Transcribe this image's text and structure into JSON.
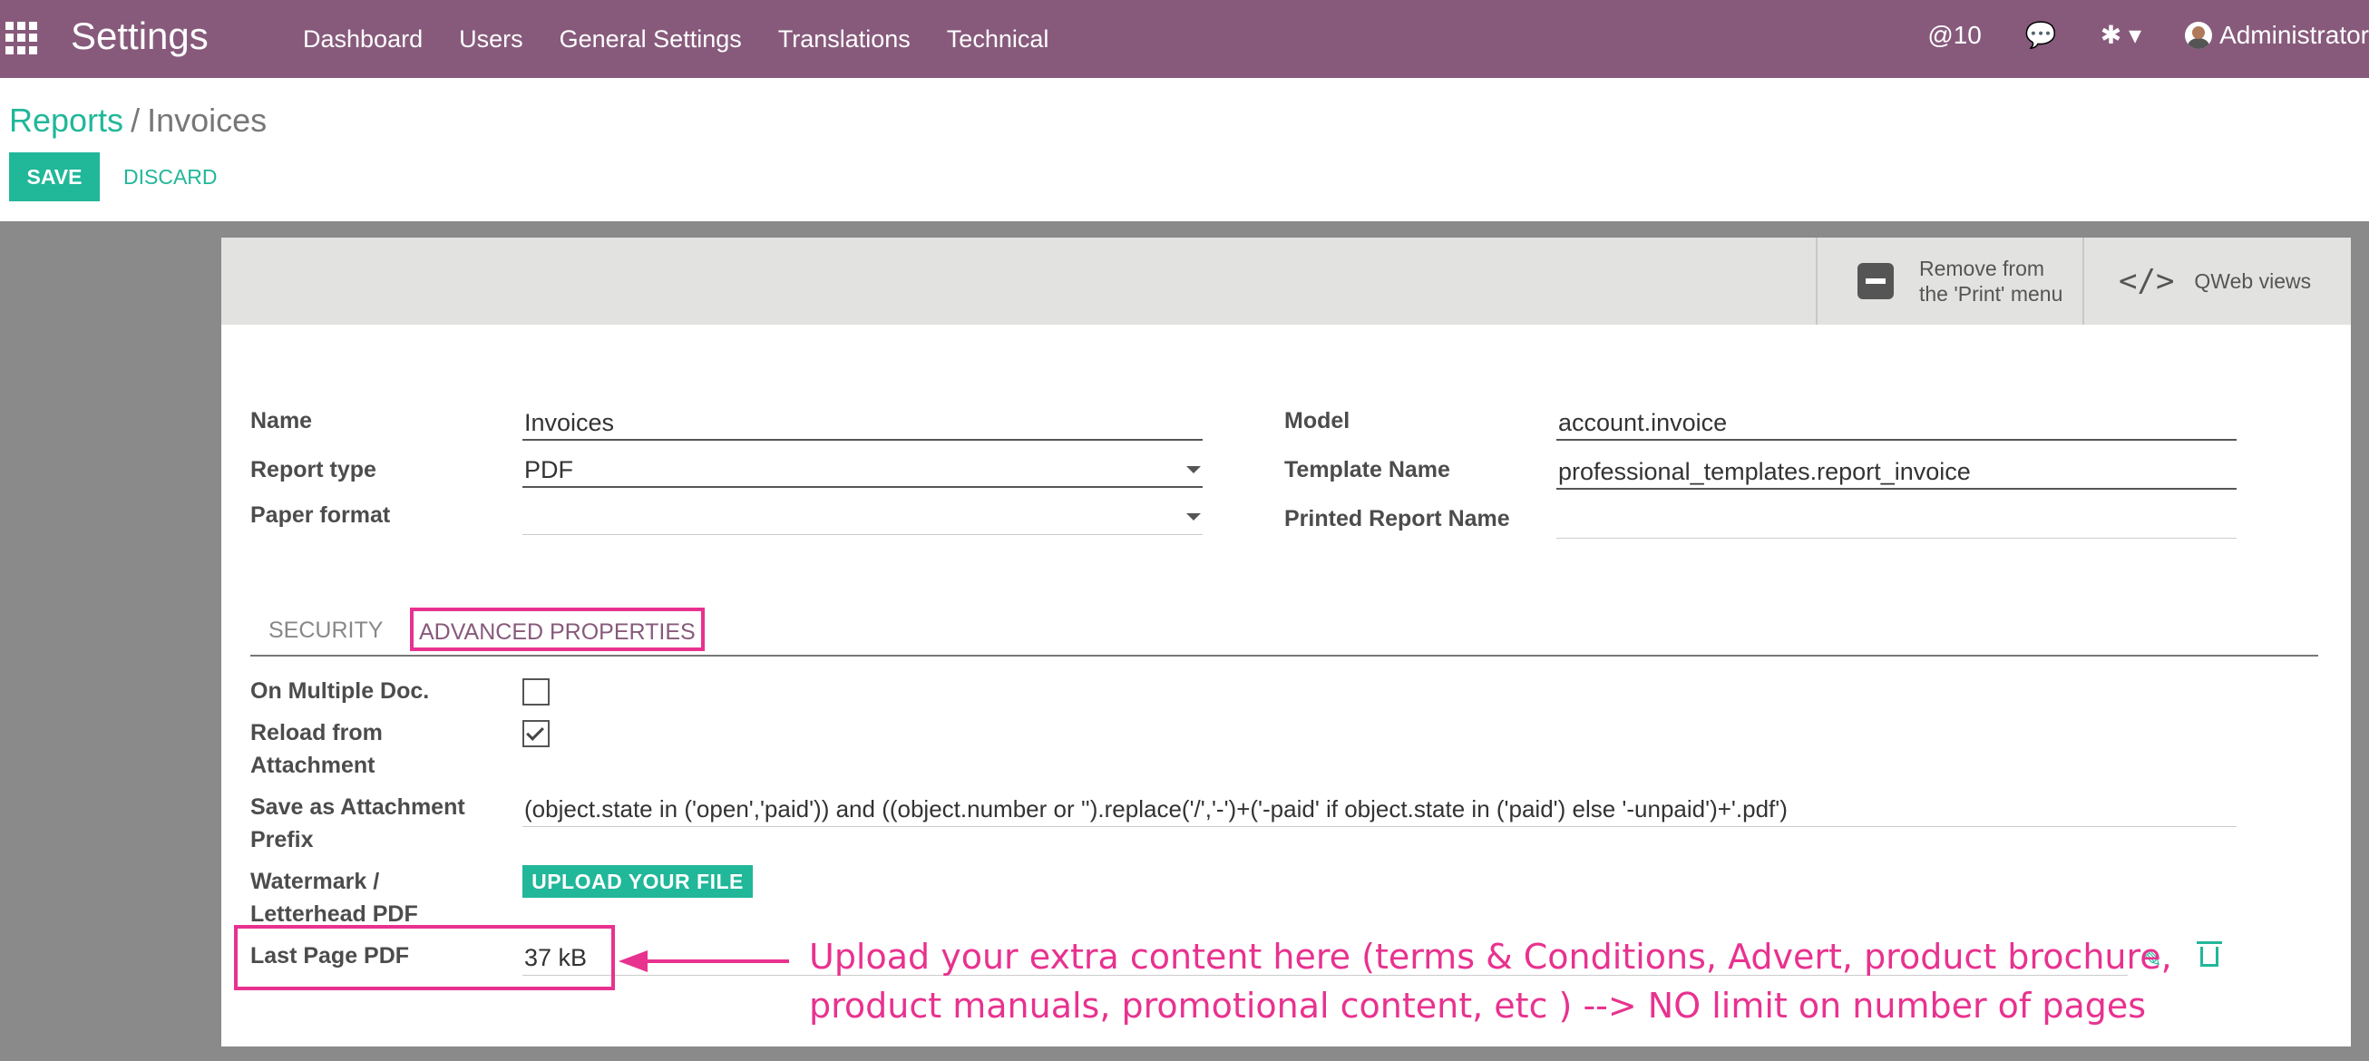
{
  "navbar": {
    "brand": "Settings",
    "menu": [
      "Dashboard",
      "Users",
      "General Settings",
      "Translations",
      "Technical"
    ],
    "mentions": "@10",
    "user": "Administrator"
  },
  "breadcrumb": {
    "parent": "Reports",
    "separator": "/",
    "current": "Invoices"
  },
  "buttons": {
    "save": "SAVE",
    "discard": "DISCARD",
    "upload": "UPLOAD YOUR FILE"
  },
  "button_box": {
    "remove": "Remove from the 'Print' menu",
    "qweb": "QWeb views"
  },
  "form": {
    "name_label": "Name",
    "name_value": "Invoices",
    "report_type_label": "Report type",
    "report_type_value": "PDF",
    "paper_format_label": "Paper format",
    "paper_format_value": "",
    "model_label": "Model",
    "model_value": "account.invoice",
    "template_label": "Template Name",
    "template_value": "professional_templates.report_invoice",
    "printed_name_label": "Printed Report Name",
    "printed_name_value": ""
  },
  "tabs": {
    "security": "SECURITY",
    "advanced": "ADVANCED PROPERTIES"
  },
  "advanced": {
    "multi_doc_label": "On Multiple Doc.",
    "multi_doc_checked": false,
    "reload_label": "Reload from Attachment",
    "reload_checked": true,
    "prefix_label": "Save as Attachment Prefix",
    "prefix_value": "(object.state in ('open','paid')) and ((object.number or '').replace('/','-')+('-paid' if object.state in ('paid') else '-unpaid')+'.pdf')",
    "watermark_label": "Watermark / Letterhead PDF",
    "last_page_label": "Last Page PDF",
    "last_page_value": "37 kB"
  },
  "annotation": {
    "line1": "Upload your extra content here (terms & Conditions, Advert, product brochure,",
    "line2": "product manuals, promotional content, etc ) --> NO limit on number of pages"
  },
  "colors": {
    "navbar": "#875a7b",
    "accent": "#21b799",
    "highlight": "#e8328f"
  }
}
